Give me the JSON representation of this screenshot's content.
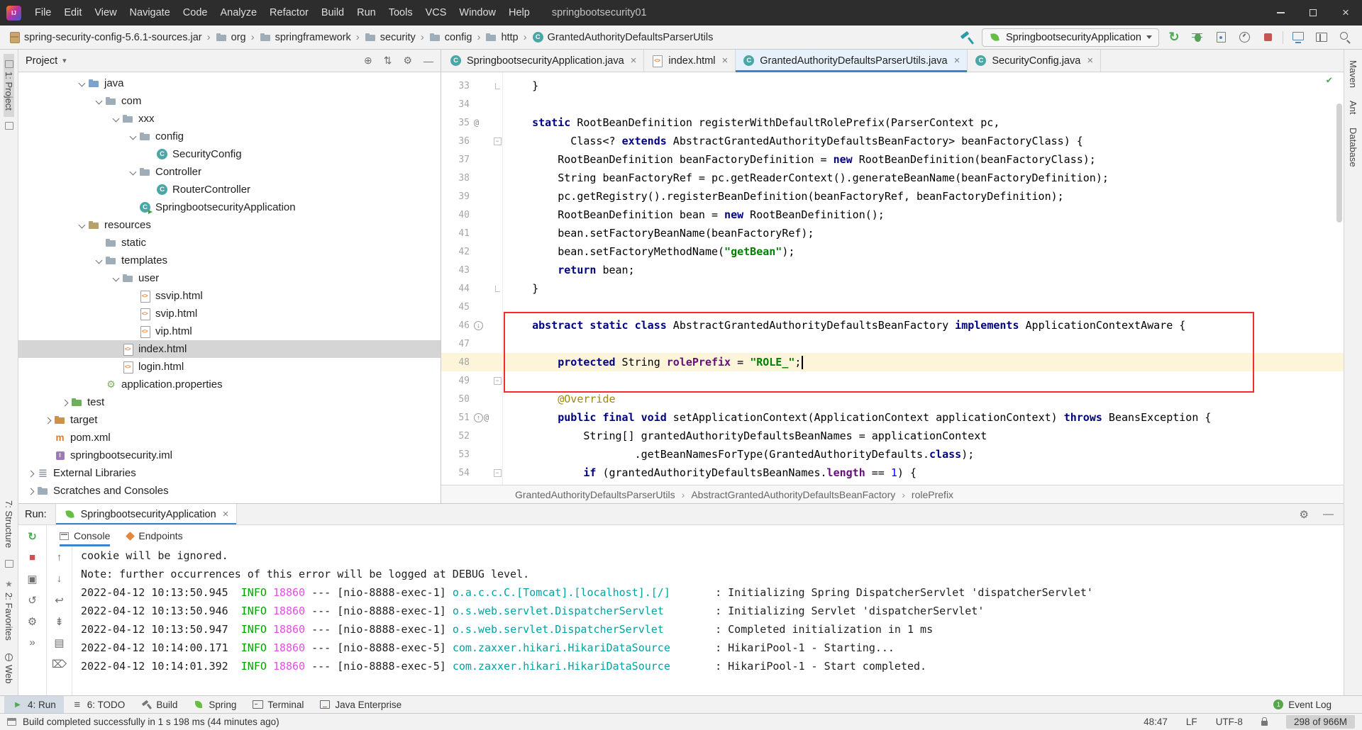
{
  "colors": {
    "accent": "#4083c9",
    "keyword": "#000080",
    "string": "#008000",
    "annotation": "#9e880d",
    "field": "#660e7a",
    "number": "#0000ff",
    "info": "#00a300",
    "pid": "#e34fe3",
    "logger": "#00a3a3",
    "annotation_box": "#fa2a2a",
    "selection": "#d5d5d5",
    "caret_line": "#fcf5da",
    "leaf_green": "#68bd45"
  },
  "titlebar": {
    "app_icon_text": "IJ",
    "menus": [
      "File",
      "Edit",
      "View",
      "Navigate",
      "Code",
      "Analyze",
      "Refactor",
      "Build",
      "Run",
      "Tools",
      "VCS",
      "Window",
      "Help"
    ],
    "title": "springbootsecurity01"
  },
  "toolbar": {
    "breadcrumbs": [
      {
        "label": "spring-security-config-5.6.1-sources.jar",
        "icon": "jar"
      },
      {
        "label": "org",
        "icon": "folder"
      },
      {
        "label": "springframework",
        "icon": "folder"
      },
      {
        "label": "security",
        "icon": "folder"
      },
      {
        "label": "config",
        "icon": "folder"
      },
      {
        "label": "http",
        "icon": "folder"
      },
      {
        "label": "GrantedAuthorityDefaultsParserUtils",
        "icon": "class"
      }
    ],
    "run_config": {
      "label": "SpringbootsecurityApplication",
      "icon": "spring-leaf"
    },
    "right_icons": [
      {
        "name": "rerun-icon"
      },
      {
        "name": "debug-icon"
      },
      {
        "name": "coverage-icon"
      },
      {
        "name": "profiler-icon"
      },
      {
        "name": "stop-icon"
      },
      {
        "name": "separator"
      },
      {
        "name": "remote-icon"
      },
      {
        "name": "layout-icon"
      },
      {
        "name": "search-icon"
      }
    ]
  },
  "left_stripe": {
    "project": "1: Project",
    "structure": "7: Structure",
    "favorites": "2: Favorites",
    "web": "Web"
  },
  "right_stripe": {
    "maven": "Maven",
    "ant": "Ant",
    "database": "Database"
  },
  "project": {
    "title": "Project",
    "header_icons": [
      {
        "name": "locate-icon",
        "glyph": "⊕"
      },
      {
        "name": "collapse-all-icon",
        "glyph": "⇅"
      },
      {
        "name": "settings-icon",
        "glyph": "⚙"
      },
      {
        "name": "hide-icon",
        "glyph": "—"
      }
    ],
    "tree": [
      {
        "label": "java",
        "level": 3,
        "icon": "folder-src",
        "arrow": "open"
      },
      {
        "label": "com",
        "level": 4,
        "icon": "folder",
        "arrow": "open"
      },
      {
        "label": "xxx",
        "level": 5,
        "icon": "folder",
        "arrow": "open"
      },
      {
        "label": "config",
        "level": 6,
        "icon": "folder",
        "arrow": "open"
      },
      {
        "label": "SecurityConfig",
        "level": 7,
        "icon": "class"
      },
      {
        "label": "Controller",
        "level": 6,
        "icon": "folder",
        "arrow": "open"
      },
      {
        "label": "RouterController",
        "level": 7,
        "icon": "class"
      },
      {
        "label": "SpringbootsecurityApplication",
        "level": 6,
        "icon": "class-run"
      },
      {
        "label": "resources",
        "level": 3,
        "icon": "folder-res",
        "arrow": "open"
      },
      {
        "label": "static",
        "level": 4,
        "icon": "folder"
      },
      {
        "label": "templates",
        "level": 4,
        "icon": "folder",
        "arrow": "open"
      },
      {
        "label": "user",
        "level": 5,
        "icon": "folder",
        "arrow": "open"
      },
      {
        "label": "ssvip.html",
        "level": 6,
        "icon": "html"
      },
      {
        "label": "svip.html",
        "level": 6,
        "icon": "html"
      },
      {
        "label": "vip.html",
        "level": 6,
        "icon": "html"
      },
      {
        "label": "index.html",
        "level": 5,
        "icon": "html",
        "selected": true
      },
      {
        "label": "login.html",
        "level": 5,
        "icon": "html"
      },
      {
        "label": "application.properties",
        "level": 4,
        "icon": "spring-props"
      },
      {
        "label": "test",
        "level": 2,
        "icon": "folder-test",
        "arrow": "closed"
      },
      {
        "label": "target",
        "level": 1,
        "icon": "folder-excluded",
        "arrow": "closed"
      },
      {
        "label": "pom.xml",
        "level": 1,
        "icon": "maven"
      },
      {
        "label": "springbootsecurity.iml",
        "level": 1,
        "icon": "iml"
      },
      {
        "label": "External Libraries",
        "level": 0,
        "icon": "lib",
        "arrow": "closed"
      },
      {
        "label": "Scratches and Consoles",
        "level": 0,
        "icon": "scratch",
        "arrow": "closed"
      }
    ]
  },
  "editor": {
    "tabs": [
      {
        "label": "SpringbootsecurityApplication.java",
        "icon": "class",
        "active": false
      },
      {
        "label": "index.html",
        "icon": "html",
        "active": false
      },
      {
        "label": "GrantedAuthorityDefaultsParserUtils.java",
        "icon": "class",
        "active": true
      },
      {
        "label": "SecurityConfig.java",
        "icon": "class",
        "active": false
      }
    ],
    "breadcrumbs": [
      "GrantedAuthorityDefaultsParserUtils",
      "AbstractGrantedAuthorityDefaultsBeanFactory",
      "rolePrefix"
    ],
    "lines": [
      {
        "n": 33,
        "f": "end",
        "segs": [
          [
            "    }",
            "p"
          ]
        ]
      },
      {
        "n": 34,
        "segs": []
      },
      {
        "n": 35,
        "g": "at",
        "segs": [
          [
            "    ",
            "p"
          ],
          [
            "static",
            "k"
          ],
          [
            " RootBeanDefinition registerWithDefaultRolePrefix(ParserContext pc,",
            "p"
          ]
        ]
      },
      {
        "n": 36,
        "f": "box",
        "segs": [
          [
            "          Class<? ",
            "p"
          ],
          [
            "extends",
            "k"
          ],
          [
            " AbstractGrantedAuthorityDefaultsBeanFactory> beanFactoryClass) {",
            "p"
          ]
        ]
      },
      {
        "n": 37,
        "segs": [
          [
            "        RootBeanDefinition beanFactoryDefinition = ",
            "p"
          ],
          [
            "new",
            "k"
          ],
          [
            " RootBeanDefinition(beanFactoryClass);",
            "p"
          ]
        ]
      },
      {
        "n": 38,
        "segs": [
          [
            "        String beanFactoryRef = pc.getReaderContext().generateBeanName(beanFactoryDefinition);",
            "p"
          ]
        ]
      },
      {
        "n": 39,
        "segs": [
          [
            "        pc.getRegistry().registerBeanDefinition(beanFactoryRef, beanFactoryDefinition);",
            "p"
          ]
        ]
      },
      {
        "n": 40,
        "segs": [
          [
            "        RootBeanDefinition bean = ",
            "p"
          ],
          [
            "new",
            "k"
          ],
          [
            " RootBeanDefinition();",
            "p"
          ]
        ]
      },
      {
        "n": 41,
        "segs": [
          [
            "        bean.setFactoryBeanName(beanFactoryRef);",
            "p"
          ]
        ]
      },
      {
        "n": 42,
        "segs": [
          [
            "        bean.setFactoryMethodName(",
            "p"
          ],
          [
            "\"getBean\"",
            "s"
          ],
          [
            ");",
            "p"
          ]
        ]
      },
      {
        "n": 43,
        "segs": [
          [
            "        ",
            "p"
          ],
          [
            "return",
            "k"
          ],
          [
            " bean;",
            "p"
          ]
        ]
      },
      {
        "n": 44,
        "f": "end",
        "segs": [
          [
            "    }",
            "p"
          ]
        ]
      },
      {
        "n": 45,
        "segs": []
      },
      {
        "n": 46,
        "g": "impl",
        "segs": [
          [
            "    ",
            "p"
          ],
          [
            "abstract static class",
            "k"
          ],
          [
            " AbstractGrantedAuthorityDefaultsBeanFactory ",
            "p"
          ],
          [
            "implements",
            "k"
          ],
          [
            " ApplicationContextAware {",
            "p"
          ]
        ]
      },
      {
        "n": 47,
        "segs": []
      },
      {
        "n": 48,
        "hl": true,
        "segs": [
          [
            "        ",
            "p"
          ],
          [
            "protected",
            "k"
          ],
          [
            " String ",
            "p"
          ],
          [
            "rolePrefix",
            "f"
          ],
          [
            " = ",
            "p"
          ],
          [
            "\"ROLE_\"",
            "s"
          ],
          [
            ";",
            "p"
          ],
          [
            "",
            "c"
          ]
        ]
      },
      {
        "n": 49,
        "f": "box",
        "segs": []
      },
      {
        "n": 50,
        "segs": [
          [
            "        ",
            "p"
          ],
          [
            "@Override",
            "a"
          ]
        ]
      },
      {
        "n": 51,
        "g": "over",
        "segs": [
          [
            "        ",
            "p"
          ],
          [
            "public final void",
            "k"
          ],
          [
            " setApplicationContext(ApplicationContext applicationContext) ",
            "p"
          ],
          [
            "throws",
            "k"
          ],
          [
            " BeansException {",
            "p"
          ]
        ]
      },
      {
        "n": 52,
        "segs": [
          [
            "            String[] grantedAuthorityDefaultsBeanNames = applicationContext",
            "p"
          ]
        ]
      },
      {
        "n": 53,
        "segs": [
          [
            "                    .getBeanNamesForType(GrantedAuthorityDefaults.",
            "p"
          ],
          [
            "class",
            "k"
          ],
          [
            ");",
            "p"
          ]
        ]
      },
      {
        "n": 54,
        "f": "box",
        "segs": [
          [
            "            ",
            "p"
          ],
          [
            "if",
            "k"
          ],
          [
            " (grantedAuthorityDefaultsBeanNames.",
            "p"
          ],
          [
            "length",
            "f"
          ],
          [
            " == ",
            "p"
          ],
          [
            "1",
            "n"
          ],
          [
            ") {",
            "p"
          ]
        ]
      }
    ]
  },
  "run": {
    "label": "Run:",
    "tab_label": "SpringbootsecurityApplication",
    "tab_icon": "spring-leaf",
    "header_icons": [
      {
        "name": "settings-icon",
        "glyph": "⚙"
      },
      {
        "name": "hide-icon",
        "glyph": "—"
      }
    ],
    "window_icons": [
      {
        "name": "rerun-icon",
        "glyph": "↻",
        "color": "green"
      },
      {
        "name": "stop-icon",
        "glyph": "■",
        "color": "red"
      },
      {
        "name": "thread-dump-icon",
        "glyph": "▣"
      },
      {
        "name": "restore-layout-icon",
        "glyph": "↺"
      },
      {
        "name": "settings-icon",
        "glyph": "⚙"
      },
      {
        "name": "pin-icon",
        "glyph": "»"
      }
    ],
    "console_icons": [
      {
        "name": "prev-trace-icon",
        "glyph": "↑"
      },
      {
        "name": "next-trace-icon",
        "glyph": "↓"
      },
      {
        "name": "soft-wrap-icon",
        "glyph": "↩"
      },
      {
        "name": "scroll-end-icon",
        "glyph": "⇟"
      },
      {
        "name": "print-icon",
        "glyph": "▤"
      },
      {
        "name": "clear-icon",
        "glyph": "⌦"
      }
    ],
    "tabs": [
      {
        "label": "Console",
        "icon": "console-icon",
        "active": true
      },
      {
        "label": "Endpoints",
        "icon": "endpoints-icon",
        "active": false
      }
    ],
    "console_lines": [
      {
        "segs": [
          [
            "cookie will be ignored.",
            "p"
          ]
        ]
      },
      {
        "segs": [
          [
            "Note: further occurrences of this error will be logged at DEBUG level.",
            "p"
          ]
        ]
      },
      {
        "segs": [
          [
            "2022-04-12 10:13:50.945  ",
            "p"
          ],
          [
            "INFO",
            "info"
          ],
          [
            " ",
            "p"
          ],
          [
            "18860",
            "pid"
          ],
          [
            " --- [nio-8888-exec-1] ",
            "p"
          ],
          [
            "o.a.c.c.C.[Tomcat].[localhost].[/]",
            "logger"
          ],
          [
            "       : Initializing Spring DispatcherServlet 'dispatcherServlet'",
            "p"
          ]
        ]
      },
      {
        "segs": [
          [
            "2022-04-12 10:13:50.946  ",
            "p"
          ],
          [
            "INFO",
            "info"
          ],
          [
            " ",
            "p"
          ],
          [
            "18860",
            "pid"
          ],
          [
            " --- [nio-8888-exec-1] ",
            "p"
          ],
          [
            "o.s.web.servlet.DispatcherServlet",
            "logger"
          ],
          [
            "        : Initializing Servlet 'dispatcherServlet'",
            "p"
          ]
        ]
      },
      {
        "segs": [
          [
            "2022-04-12 10:13:50.947  ",
            "p"
          ],
          [
            "INFO",
            "info"
          ],
          [
            " ",
            "p"
          ],
          [
            "18860",
            "pid"
          ],
          [
            " --- [nio-8888-exec-1] ",
            "p"
          ],
          [
            "o.s.web.servlet.DispatcherServlet",
            "logger"
          ],
          [
            "        : Completed initialization in 1 ms",
            "p"
          ]
        ]
      },
      {
        "segs": [
          [
            "2022-04-12 10:14:00.171  ",
            "p"
          ],
          [
            "INFO",
            "info"
          ],
          [
            " ",
            "p"
          ],
          [
            "18860",
            "pid"
          ],
          [
            " --- [nio-8888-exec-5] ",
            "p"
          ],
          [
            "com.zaxxer.hikari.HikariDataSource",
            "logger"
          ],
          [
            "       : HikariPool-1 - Starting...",
            "p"
          ]
        ]
      },
      {
        "segs": [
          [
            "2022-04-12 10:14:01.392  ",
            "p"
          ],
          [
            "INFO",
            "info"
          ],
          [
            " ",
            "p"
          ],
          [
            "18860",
            "pid"
          ],
          [
            " --- [nio-8888-exec-5] ",
            "p"
          ],
          [
            "com.zaxxer.hikari.HikariDataSource",
            "logger"
          ],
          [
            "       : HikariPool-1 - Start completed.",
            "p"
          ]
        ]
      }
    ]
  },
  "bottom_toolbar": {
    "left": [
      {
        "label": "4: Run",
        "icon": "run-icon",
        "active": true
      },
      {
        "label": "6: TODO",
        "icon": "todo-icon",
        "active": false
      },
      {
        "label": "Build",
        "icon": "build-icon",
        "active": false
      },
      {
        "label": "Spring",
        "icon": "spring-icon",
        "active": false
      },
      {
        "label": "Terminal",
        "icon": "terminal-icon",
        "active": false
      },
      {
        "label": "Java Enterprise",
        "icon": "jee-icon",
        "active": false
      }
    ],
    "right": [
      {
        "label": "Event Log",
        "icon": "event-icon"
      }
    ]
  },
  "status_bar": {
    "message": "Build completed successfully in 1 s 198 ms (44 minutes ago)",
    "position": "48:47",
    "line_separator": "LF",
    "encoding": "UTF-8",
    "memory": "298 of 966M"
  }
}
